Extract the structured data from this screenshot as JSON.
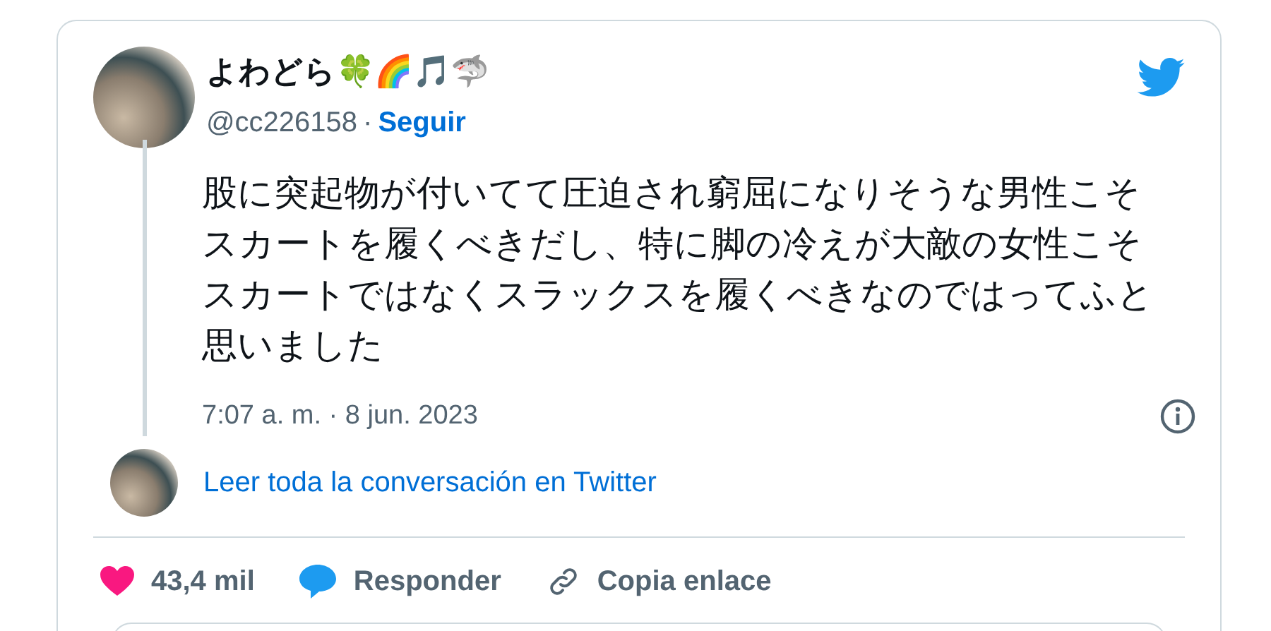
{
  "tweet": {
    "author_name": "よわどら🍀🌈🎵🦈",
    "handle": "@cc226158",
    "separator": "·",
    "follow_link": "Seguir",
    "text": "股に突起物が付いてて圧迫され窮屈になりそうな男性こそスカートを履くべきだし、特に脚の冷えが大敵の女性こそスカートではなくスラックスを履くべきなのではってふと思いました",
    "timestamp": "7:07 a. m. · 8 jun. 2023",
    "conversation_link": "Leer toda la conversación en Twitter",
    "actions": [
      {
        "kind": "like",
        "label": "43,4 mil"
      },
      {
        "kind": "reply",
        "label": "Responder"
      },
      {
        "kind": "copy",
        "label": "Copia enlace"
      }
    ]
  }
}
